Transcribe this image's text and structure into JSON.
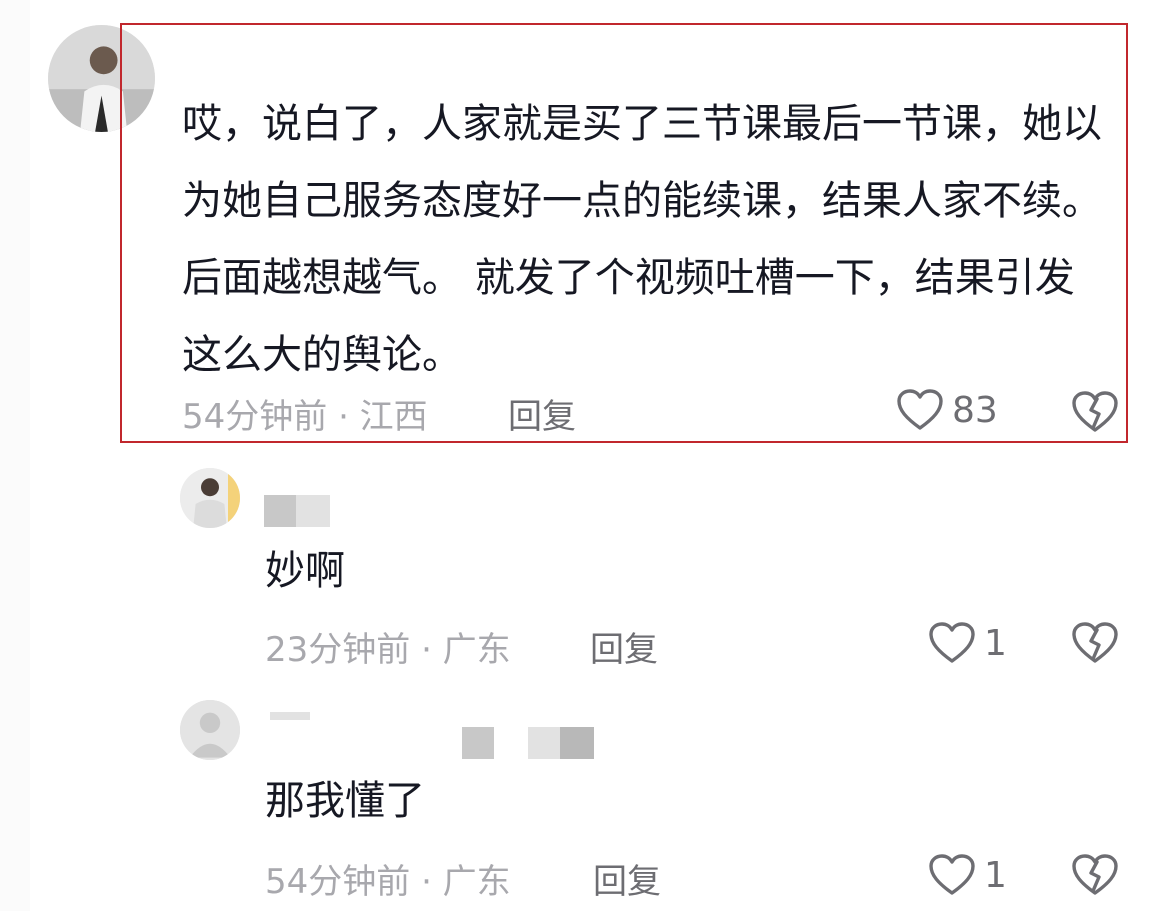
{
  "comments": [
    {
      "text": "哎，说白了，人家就是买了三节课最后一节课，她以为她自己服务态度好一点的能续课，结果人家不续。后面越想越气。 就发了个视频吐槽一下，结果引发这么大的舆论。",
      "meta": "54分钟前 · 江西",
      "reply": "回复",
      "likes": "83"
    },
    {
      "text": "妙啊",
      "meta": "23分钟前 · 广东",
      "reply": "回复",
      "likes": "1"
    },
    {
      "text": "那我懂了",
      "meta": "54分钟前 · 广东",
      "reply": "回复",
      "likes": "1"
    }
  ],
  "icons": {
    "like": "heart-outline-icon",
    "dislike": "broken-heart-icon"
  },
  "colors": {
    "text": "#161823",
    "meta": "#a8a8ad",
    "action": "#6d6d72",
    "highlight": "#c1272d"
  }
}
